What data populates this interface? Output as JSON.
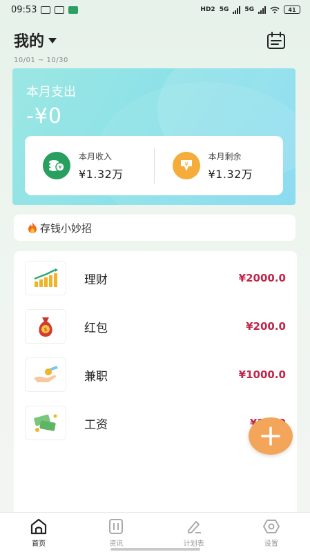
{
  "status_bar": {
    "time": "09:53",
    "network_hd": "HD2",
    "network_1": "5G",
    "network_2": "5G",
    "battery": "41"
  },
  "header": {
    "title": "我的",
    "date_range": "10/01 ~ 10/30"
  },
  "summary": {
    "expense_label": "本月支出",
    "expense_value": "-¥0",
    "income_label": "本月收入",
    "income_value": "¥1.32万",
    "remaining_label": "本月剩余",
    "remaining_value": "¥1.32万"
  },
  "tips": {
    "label": "存钱小妙招"
  },
  "items": [
    {
      "label": "理财",
      "amount": "¥2000.0"
    },
    {
      "label": "红包",
      "amount": "¥200.0"
    },
    {
      "label": "兼职",
      "amount": "¥1000.0"
    },
    {
      "label": "工资",
      "amount": "¥1000"
    }
  ],
  "tabs": [
    {
      "label": "首页"
    },
    {
      "label": "资讯"
    },
    {
      "label": "计划表"
    },
    {
      "label": "设置"
    }
  ],
  "colors": {
    "accent_card": "#8be1e8",
    "amount": "#c0274a",
    "fab": "#f3a65a",
    "income_icon": "#27a05f",
    "remaining_icon": "#f5ac3a"
  }
}
